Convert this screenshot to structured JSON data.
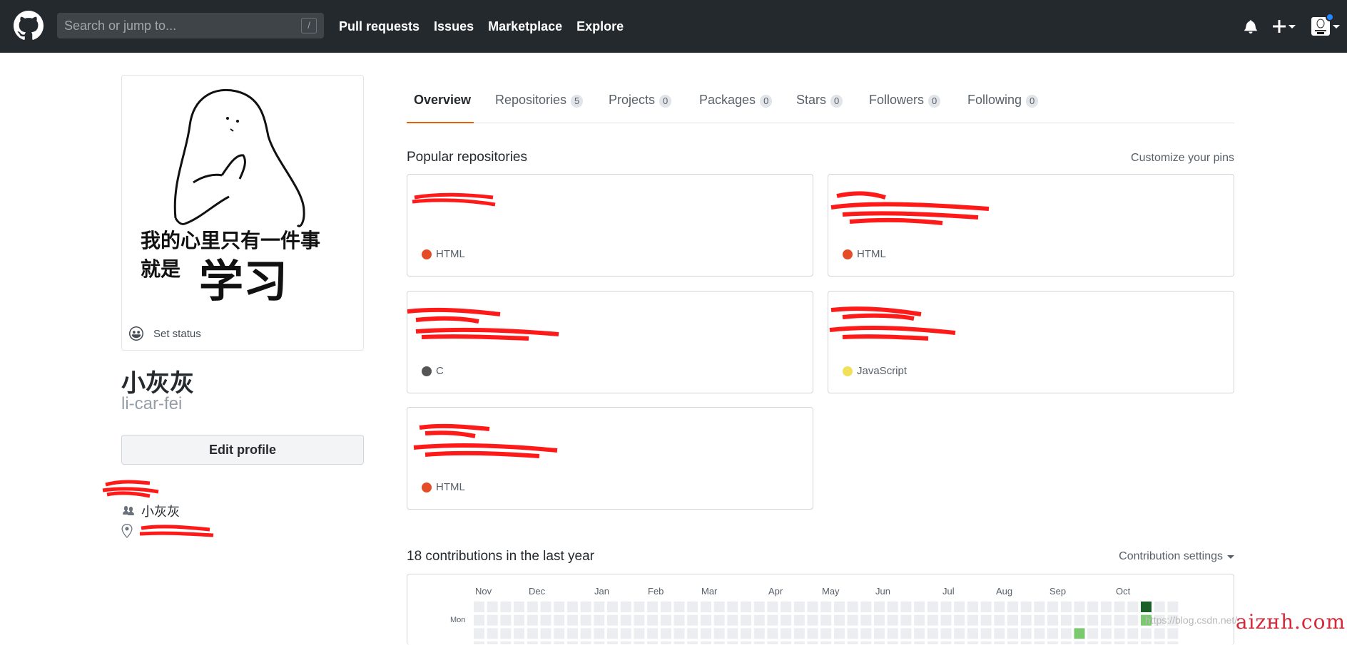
{
  "header": {
    "search_placeholder": "Search or jump to...",
    "search_shortcut": "/",
    "nav": [
      "Pull requests",
      "Issues",
      "Marketplace",
      "Explore"
    ]
  },
  "profile": {
    "avatar_caption_line1": "我的心里只有一件事",
    "avatar_caption_line2": "就是",
    "avatar_caption_big": "学习",
    "set_status": "Set status",
    "full_name": "小灰灰",
    "login": "li-car-fei",
    "edit_button": "Edit profile",
    "company": "小灰灰"
  },
  "tabs": [
    {
      "label": "Overview",
      "count": ""
    },
    {
      "label": "Repositories",
      "count": "5"
    },
    {
      "label": "Projects",
      "count": "0"
    },
    {
      "label": "Packages",
      "count": "0"
    },
    {
      "label": "Stars",
      "count": "0"
    },
    {
      "label": "Followers",
      "count": "0"
    },
    {
      "label": "Following",
      "count": "0"
    }
  ],
  "pinned": {
    "title": "Popular repositories",
    "customize": "Customize your pins",
    "repos": [
      {
        "language": "HTML",
        "color": "#e34c26"
      },
      {
        "language": "HTML",
        "color": "#e34c26"
      },
      {
        "language": "C",
        "color": "#555555"
      },
      {
        "language": "JavaScript",
        "color": "#f1e05a"
      },
      {
        "language": "HTML",
        "color": "#e34c26"
      }
    ]
  },
  "contributions": {
    "title": "18 contributions in the last year",
    "settings": "Contribution settings",
    "months": [
      "Nov",
      "Dec",
      "Jan",
      "Feb",
      "Mar",
      "Apr",
      "May",
      "Jun",
      "Jul",
      "Aug",
      "Sep",
      "Oct"
    ],
    "day_label": "Mon"
  },
  "watermark": {
    "text": "aizнh.com",
    "url": "https://blog.csdn.net/..."
  },
  "colors": {
    "header_bg": "#24292e",
    "tab_active": "#e36209",
    "level_empty": "#ebedf0",
    "level_1": "#7bc96f",
    "level_4": "#196127"
  }
}
